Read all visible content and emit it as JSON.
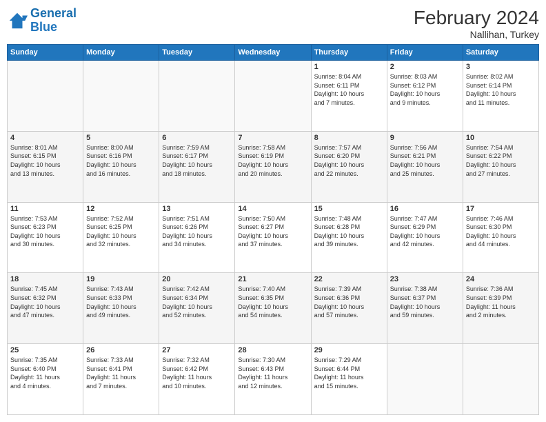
{
  "header": {
    "logo_line1": "General",
    "logo_line2": "Blue",
    "month_year": "February 2024",
    "location": "Nallihan, Turkey"
  },
  "weekdays": [
    "Sunday",
    "Monday",
    "Tuesday",
    "Wednesday",
    "Thursday",
    "Friday",
    "Saturday"
  ],
  "weeks": [
    [
      {
        "day": "",
        "info": ""
      },
      {
        "day": "",
        "info": ""
      },
      {
        "day": "",
        "info": ""
      },
      {
        "day": "",
        "info": ""
      },
      {
        "day": "1",
        "info": "Sunrise: 8:04 AM\nSunset: 6:11 PM\nDaylight: 10 hours\nand 7 minutes."
      },
      {
        "day": "2",
        "info": "Sunrise: 8:03 AM\nSunset: 6:12 PM\nDaylight: 10 hours\nand 9 minutes."
      },
      {
        "day": "3",
        "info": "Sunrise: 8:02 AM\nSunset: 6:14 PM\nDaylight: 10 hours\nand 11 minutes."
      }
    ],
    [
      {
        "day": "4",
        "info": "Sunrise: 8:01 AM\nSunset: 6:15 PM\nDaylight: 10 hours\nand 13 minutes."
      },
      {
        "day": "5",
        "info": "Sunrise: 8:00 AM\nSunset: 6:16 PM\nDaylight: 10 hours\nand 16 minutes."
      },
      {
        "day": "6",
        "info": "Sunrise: 7:59 AM\nSunset: 6:17 PM\nDaylight: 10 hours\nand 18 minutes."
      },
      {
        "day": "7",
        "info": "Sunrise: 7:58 AM\nSunset: 6:19 PM\nDaylight: 10 hours\nand 20 minutes."
      },
      {
        "day": "8",
        "info": "Sunrise: 7:57 AM\nSunset: 6:20 PM\nDaylight: 10 hours\nand 22 minutes."
      },
      {
        "day": "9",
        "info": "Sunrise: 7:56 AM\nSunset: 6:21 PM\nDaylight: 10 hours\nand 25 minutes."
      },
      {
        "day": "10",
        "info": "Sunrise: 7:54 AM\nSunset: 6:22 PM\nDaylight: 10 hours\nand 27 minutes."
      }
    ],
    [
      {
        "day": "11",
        "info": "Sunrise: 7:53 AM\nSunset: 6:23 PM\nDaylight: 10 hours\nand 30 minutes."
      },
      {
        "day": "12",
        "info": "Sunrise: 7:52 AM\nSunset: 6:25 PM\nDaylight: 10 hours\nand 32 minutes."
      },
      {
        "day": "13",
        "info": "Sunrise: 7:51 AM\nSunset: 6:26 PM\nDaylight: 10 hours\nand 34 minutes."
      },
      {
        "day": "14",
        "info": "Sunrise: 7:50 AM\nSunset: 6:27 PM\nDaylight: 10 hours\nand 37 minutes."
      },
      {
        "day": "15",
        "info": "Sunrise: 7:48 AM\nSunset: 6:28 PM\nDaylight: 10 hours\nand 39 minutes."
      },
      {
        "day": "16",
        "info": "Sunrise: 7:47 AM\nSunset: 6:29 PM\nDaylight: 10 hours\nand 42 minutes."
      },
      {
        "day": "17",
        "info": "Sunrise: 7:46 AM\nSunset: 6:30 PM\nDaylight: 10 hours\nand 44 minutes."
      }
    ],
    [
      {
        "day": "18",
        "info": "Sunrise: 7:45 AM\nSunset: 6:32 PM\nDaylight: 10 hours\nand 47 minutes."
      },
      {
        "day": "19",
        "info": "Sunrise: 7:43 AM\nSunset: 6:33 PM\nDaylight: 10 hours\nand 49 minutes."
      },
      {
        "day": "20",
        "info": "Sunrise: 7:42 AM\nSunset: 6:34 PM\nDaylight: 10 hours\nand 52 minutes."
      },
      {
        "day": "21",
        "info": "Sunrise: 7:40 AM\nSunset: 6:35 PM\nDaylight: 10 hours\nand 54 minutes."
      },
      {
        "day": "22",
        "info": "Sunrise: 7:39 AM\nSunset: 6:36 PM\nDaylight: 10 hours\nand 57 minutes."
      },
      {
        "day": "23",
        "info": "Sunrise: 7:38 AM\nSunset: 6:37 PM\nDaylight: 10 hours\nand 59 minutes."
      },
      {
        "day": "24",
        "info": "Sunrise: 7:36 AM\nSunset: 6:39 PM\nDaylight: 11 hours\nand 2 minutes."
      }
    ],
    [
      {
        "day": "25",
        "info": "Sunrise: 7:35 AM\nSunset: 6:40 PM\nDaylight: 11 hours\nand 4 minutes."
      },
      {
        "day": "26",
        "info": "Sunrise: 7:33 AM\nSunset: 6:41 PM\nDaylight: 11 hours\nand 7 minutes."
      },
      {
        "day": "27",
        "info": "Sunrise: 7:32 AM\nSunset: 6:42 PM\nDaylight: 11 hours\nand 10 minutes."
      },
      {
        "day": "28",
        "info": "Sunrise: 7:30 AM\nSunset: 6:43 PM\nDaylight: 11 hours\nand 12 minutes."
      },
      {
        "day": "29",
        "info": "Sunrise: 7:29 AM\nSunset: 6:44 PM\nDaylight: 11 hours\nand 15 minutes."
      },
      {
        "day": "",
        "info": ""
      },
      {
        "day": "",
        "info": ""
      }
    ]
  ]
}
